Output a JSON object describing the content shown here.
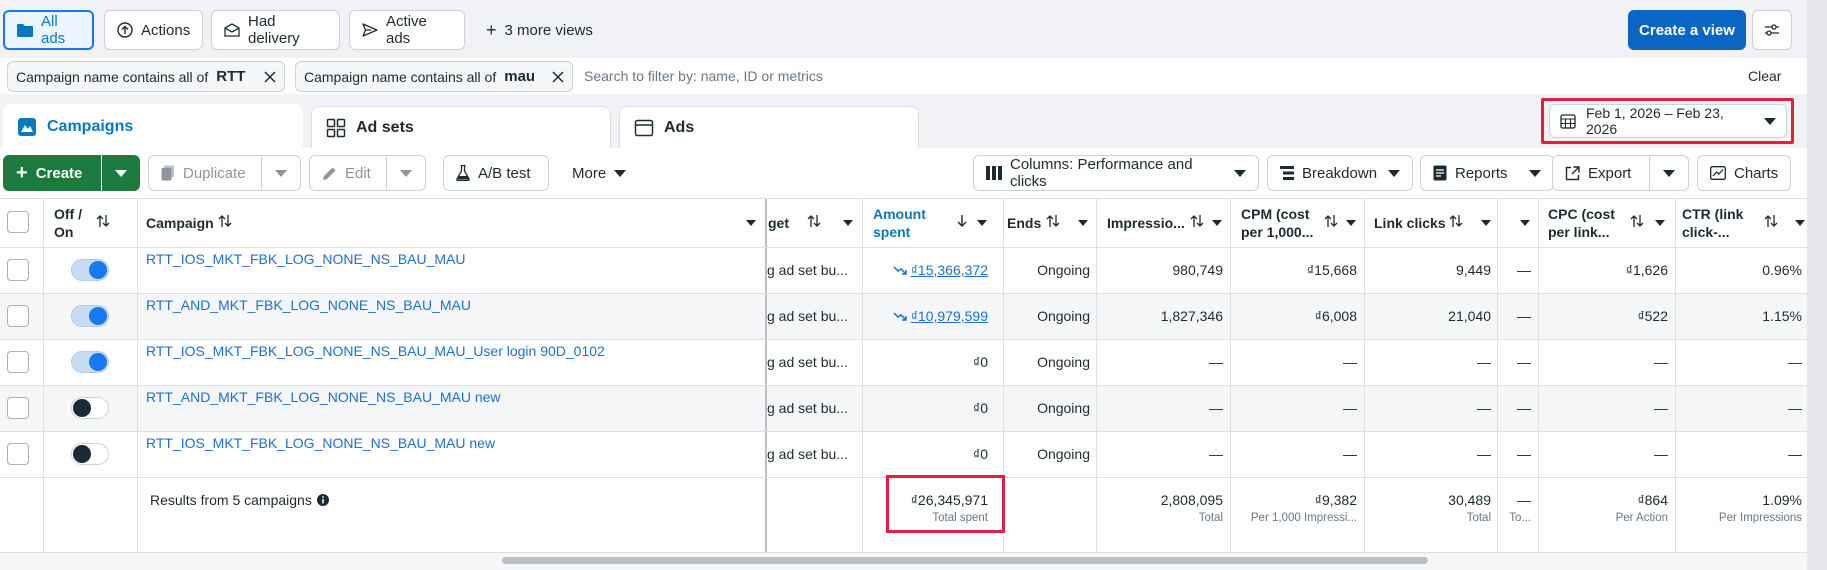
{
  "views": {
    "all_ads": "All ads",
    "actions": "Actions",
    "had_delivery": "Had delivery",
    "active_ads": "Active ads",
    "more_views": "3 more views",
    "create_view": "Create a view"
  },
  "filters": {
    "chip1_label": "Campaign name contains all of",
    "chip1_value": "RTT",
    "chip2_label": "Campaign name contains all of",
    "chip2_value": "mau",
    "search_placeholder": "Search to filter by: name, ID or metrics",
    "clear": "Clear"
  },
  "tabs": {
    "campaigns": "Campaigns",
    "ad_sets": "Ad sets",
    "ads": "Ads"
  },
  "date_range": "Feb 1, 2026 – Feb 23, 2026",
  "toolbar": {
    "create": "Create",
    "duplicate": "Duplicate",
    "edit": "Edit",
    "ab_test": "A/B test",
    "more": "More",
    "columns": "Columns: Performance and clicks",
    "breakdown": "Breakdown",
    "reports": "Reports",
    "export": "Export",
    "charts": "Charts"
  },
  "columns": {
    "off_on_1": "Off /",
    "off_on_2": "On",
    "campaign": "Campaign",
    "budget": "get",
    "amount_1": "Amount",
    "amount_2": "spent",
    "ends": "Ends",
    "impressions": "Impressio...",
    "cpm_1": "CPM (cost",
    "cpm_2": "per 1,000...",
    "link_clicks": "Link clicks",
    "cpc_1": "CPC (cost",
    "cpc_2": "per link...",
    "ctr_1": "CTR (link",
    "ctr_2": "click-..."
  },
  "rows": [
    {
      "on": true,
      "name": "RTT_IOS_MKT_FBK_LOG_NONE_NS_BAU_MAU",
      "budget": "g ad set bu...",
      "trend": true,
      "spent": "₫15,366,372",
      "ends": "Ongoing",
      "impressions": "980,749",
      "cpm": "₫15,668",
      "clicks": "9,449",
      "dash": "—",
      "cpc": "₫1,626",
      "ctr": "0.96%"
    },
    {
      "on": true,
      "name": "RTT_AND_MKT_FBK_LOG_NONE_NS_BAU_MAU",
      "budget": "g ad set bu...",
      "trend": true,
      "spent": "₫10,979,599",
      "ends": "Ongoing",
      "impressions": "1,827,346",
      "cpm": "₫6,008",
      "clicks": "21,040",
      "dash": "—",
      "cpc": "₫522",
      "ctr": "1.15%"
    },
    {
      "on": true,
      "name": "RTT_IOS_MKT_FBK_LOG_NONE_NS_BAU_MAU_User login 90D_0102",
      "budget": "g ad set bu...",
      "trend": false,
      "spent": "₫0",
      "ends": "Ongoing",
      "impressions": "—",
      "cpm": "—",
      "clicks": "—",
      "dash": "—",
      "cpc": "—",
      "ctr": "—"
    },
    {
      "on": false,
      "name": "RTT_AND_MKT_FBK_LOG_NONE_NS_BAU_MAU new",
      "budget": "g ad set bu...",
      "trend": false,
      "spent": "₫0",
      "ends": "Ongoing",
      "impressions": "—",
      "cpm": "—",
      "clicks": "—",
      "dash": "—",
      "cpc": "—",
      "ctr": "—"
    },
    {
      "on": false,
      "name": "RTT_IOS_MKT_FBK_LOG_NONE_NS_BAU_MAU new",
      "budget": "g ad set bu...",
      "trend": false,
      "spent": "₫0",
      "ends": "Ongoing",
      "impressions": "—",
      "cpm": "—",
      "clicks": "—",
      "dash": "—",
      "cpc": "—",
      "ctr": "—"
    }
  ],
  "totals": {
    "label": "Results from 5 campaigns",
    "spent": "₫26,345,971",
    "spent_sub": "Total spent",
    "impressions": "2,808,095",
    "impressions_sub": "Total",
    "cpm": "₫9,382",
    "cpm_sub": "Per 1,000 Impressi...",
    "clicks": "30,489",
    "clicks_sub": "Total",
    "dash": "—",
    "dash_sub": "To...",
    "cpc": "₫864",
    "cpc_sub": "Per Action",
    "ctr": "1.09%",
    "ctr_sub": "Per Impressions"
  },
  "colors": {
    "accent": "#1877f2",
    "highlight": "#e41e3f",
    "create_green": "#1c7a3e"
  }
}
